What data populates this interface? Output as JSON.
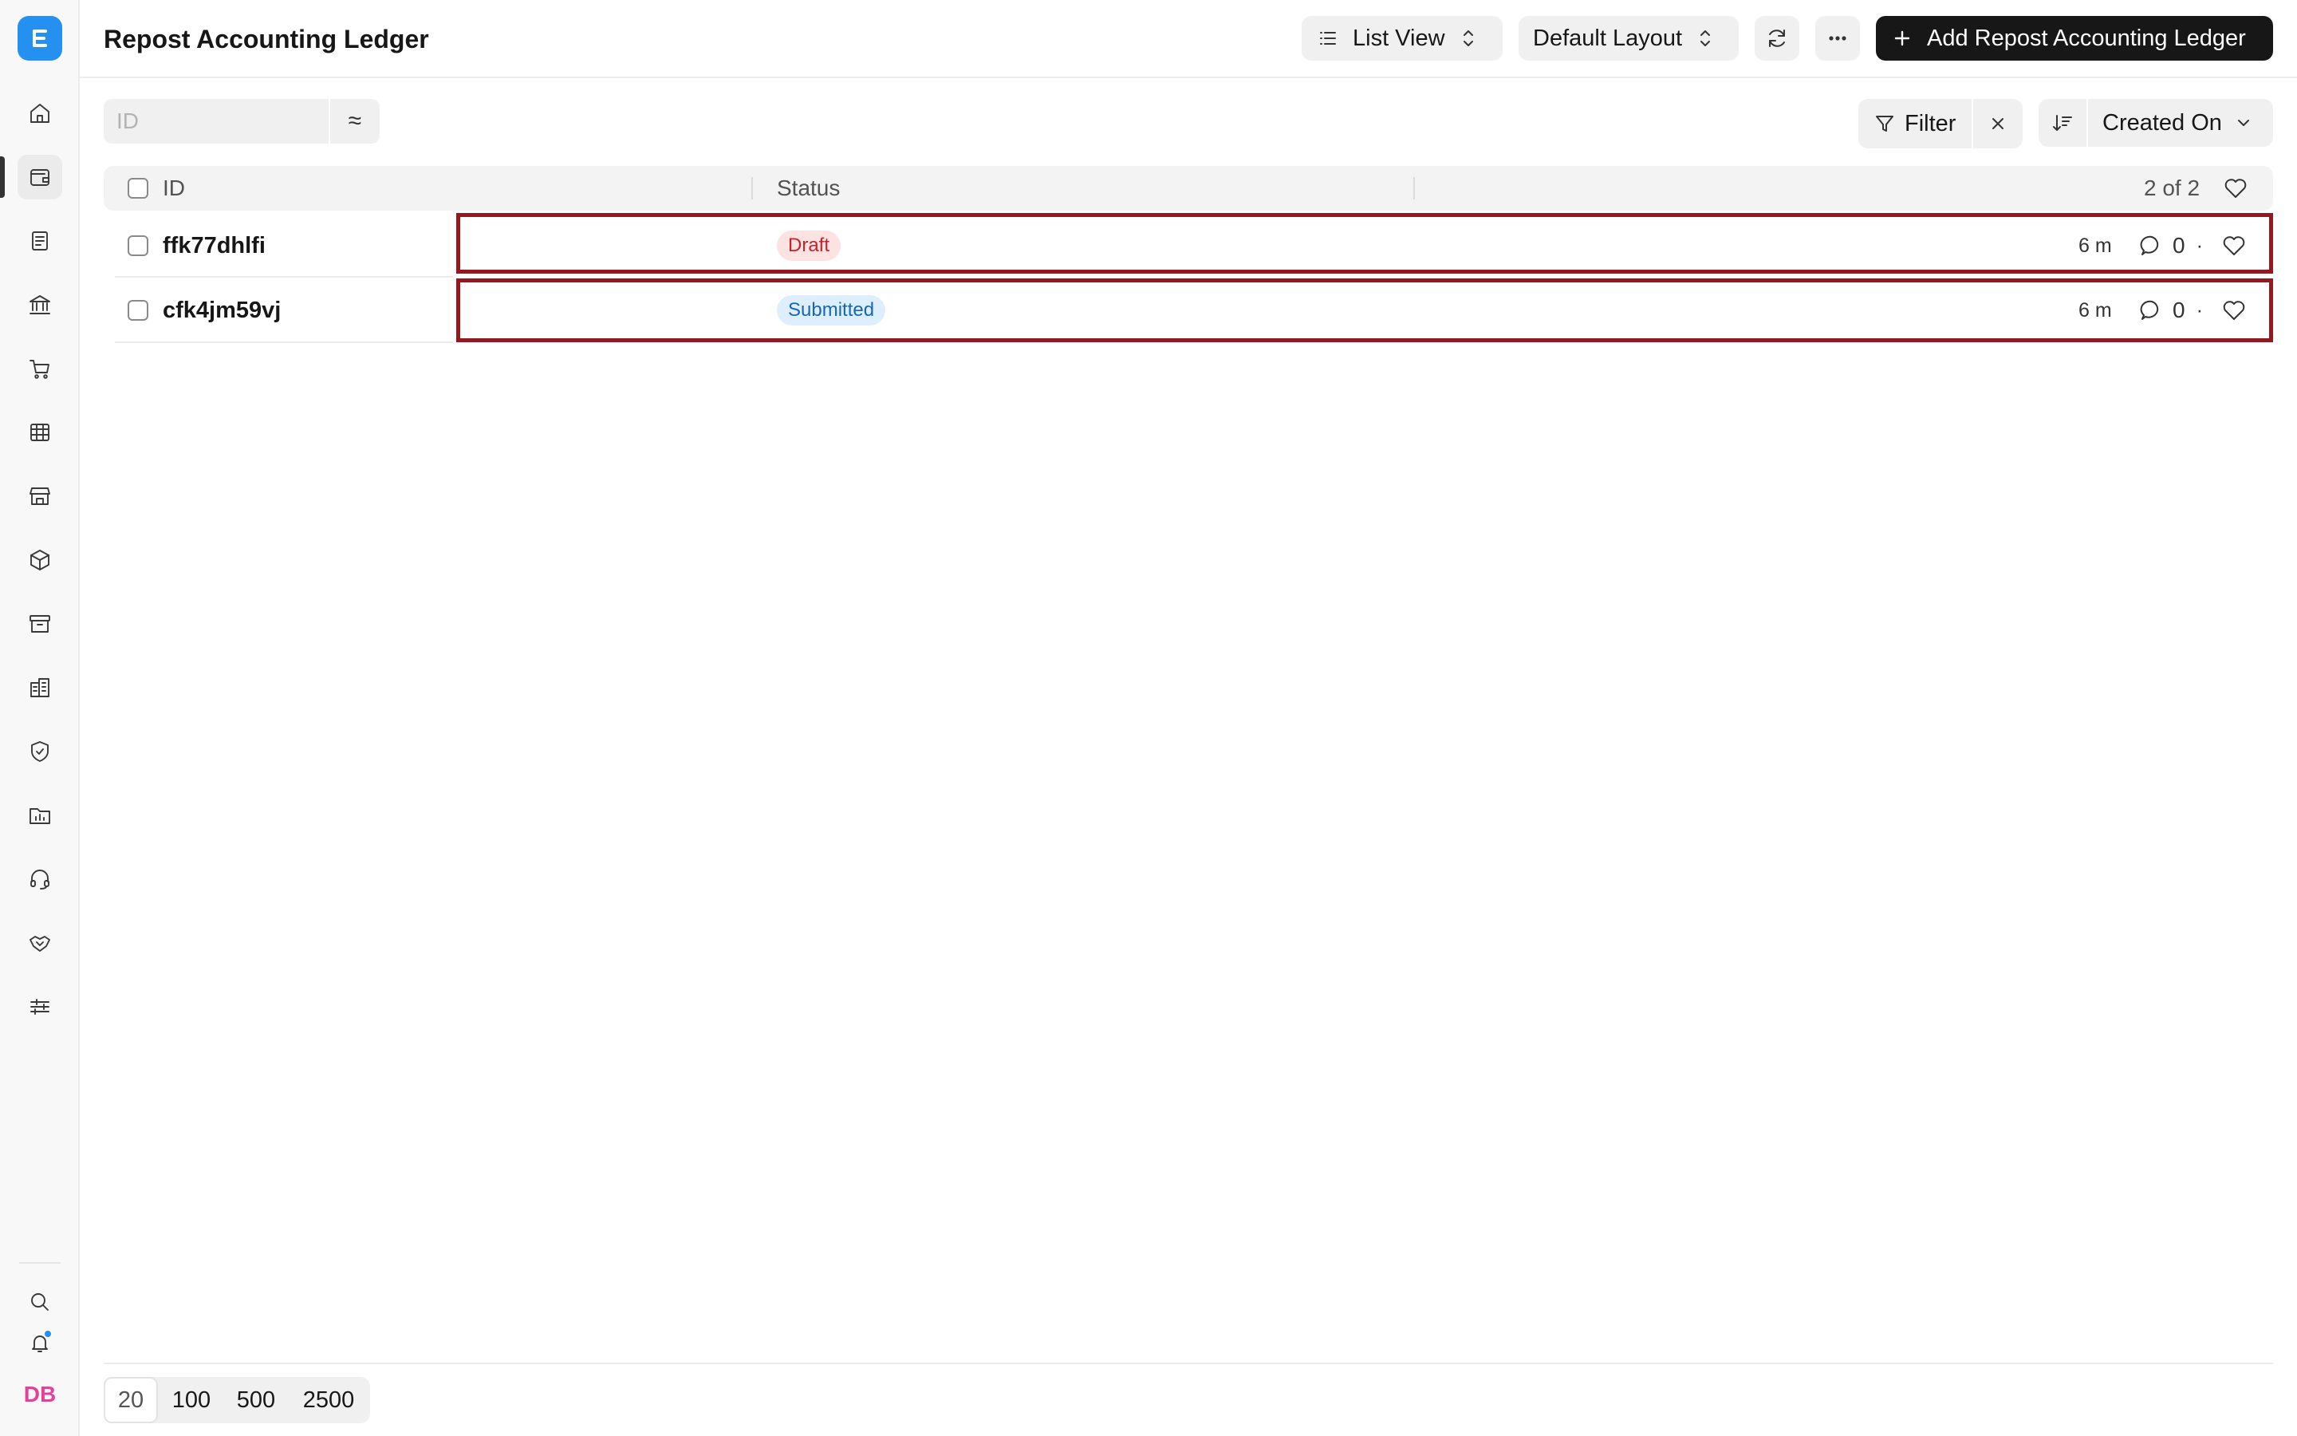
{
  "app": {
    "name": "ERPNext"
  },
  "header": {
    "title": "Repost Accounting Ledger",
    "view_selector": "List View",
    "layout_selector": "Default Layout",
    "primary_action": "Add Repost Accounting Ledger"
  },
  "sidebar": {
    "items": [
      {
        "name": "home-icon"
      },
      {
        "name": "accounting-icon",
        "active": true
      },
      {
        "name": "invoice-icon"
      },
      {
        "name": "bank-icon"
      },
      {
        "name": "cart-icon"
      },
      {
        "name": "table-icon"
      },
      {
        "name": "store-icon"
      },
      {
        "name": "package-icon"
      },
      {
        "name": "archive-icon"
      },
      {
        "name": "building-icon"
      },
      {
        "name": "shield-icon"
      },
      {
        "name": "folder-chart-icon"
      },
      {
        "name": "headset-icon"
      },
      {
        "name": "handshake-icon"
      },
      {
        "name": "sliders-icon"
      }
    ],
    "avatar_initials": "DB",
    "notification_dot_color": "#2490ef"
  },
  "toolbar": {
    "search_placeholder": "ID",
    "match_symbol": "≈",
    "filter_label": "Filter",
    "sort_field": "Created On"
  },
  "table": {
    "columns": [
      "ID",
      "Status"
    ],
    "count_label": "2 of 2",
    "rows": [
      {
        "id": "ffk77dhlfi",
        "status": "Draft",
        "status_color": "#c3232c",
        "time": "6 m",
        "comments": "0"
      },
      {
        "id": "cfk4jm59vj",
        "status": "Submitted",
        "status_color": "#1767b5",
        "time": "6 m",
        "comments": "0"
      }
    ]
  },
  "footer": {
    "page_sizes": [
      "20",
      "100",
      "500",
      "2500"
    ],
    "selected_page_size": "20"
  },
  "colors": {
    "brand": "#2490ef",
    "primary_button": "#171717",
    "highlight_border": "#94181f"
  }
}
